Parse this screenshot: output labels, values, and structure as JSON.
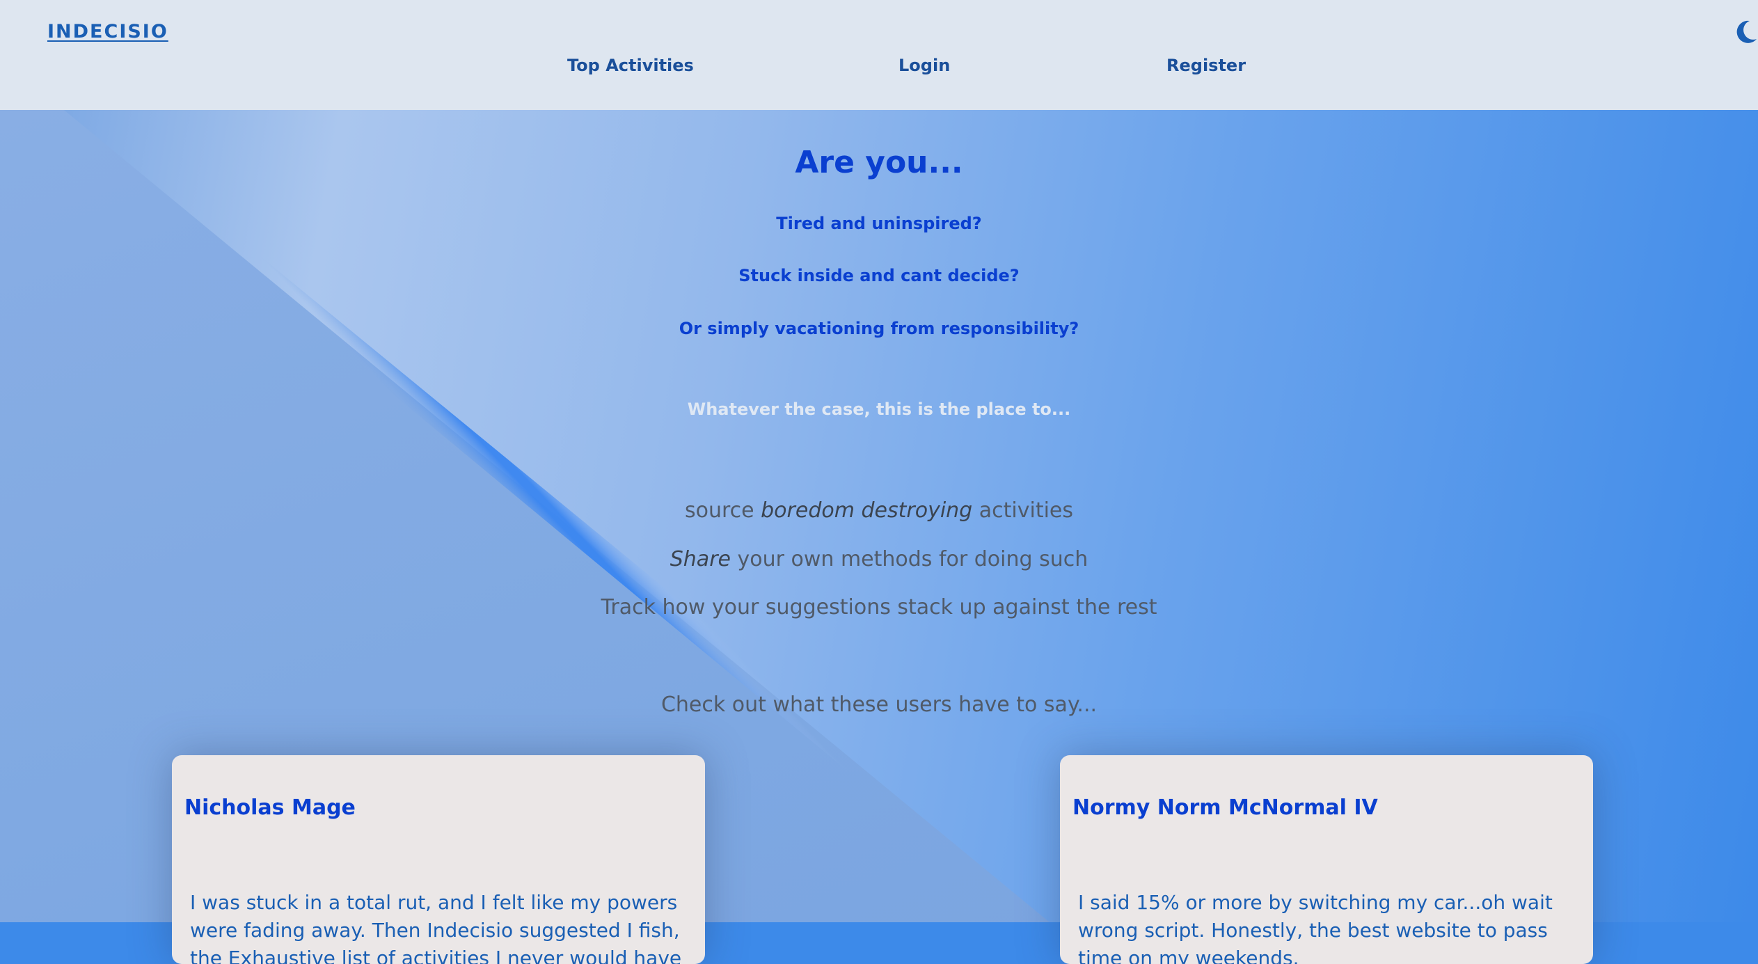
{
  "header": {
    "logo": "INDECISIO",
    "nav": [
      {
        "label": "Top Activities"
      },
      {
        "label": "Login"
      },
      {
        "label": "Register"
      }
    ],
    "theme_toggle_icon": "moon-icon"
  },
  "hero": {
    "title": "Are you...",
    "questions": [
      "Tired and uninspired?",
      "Stuck inside and cant decide?",
      "Or simply vacationing from responsibility?"
    ],
    "whatever": "Whatever the case, this is the place to...",
    "features": [
      {
        "before": "source ",
        "emphasis": "boredom destroying",
        "after": " activities"
      },
      {
        "before": "",
        "emphasis": "Share",
        "after": " your own methods for doing such"
      },
      {
        "before": "Track how your suggestions stack up against the rest",
        "emphasis": "",
        "after": ""
      }
    ],
    "check_out": "Check out what these users have to say..."
  },
  "testimonials": [
    {
      "name": "Nicholas Mage",
      "quote": "I was stuck in a total rut, and I felt like my powers were fading away. Then Indecisio suggested I fish, the Exhaustive list of activities I never would have thought of."
    },
    {
      "name": "Normy Norm McNormal IV",
      "quote": "I said 15% or more by switching my car...oh wait wrong script. Honestly, the best website to pass time on my weekends."
    }
  ],
  "colors": {
    "header_bg": "#dee6f0",
    "brand": "#1a5fb4",
    "heading": "#0a3fd0",
    "body_text": "#505a68",
    "card_bg": "#ebe7e7",
    "hero_accent": "#3d8ae9"
  }
}
